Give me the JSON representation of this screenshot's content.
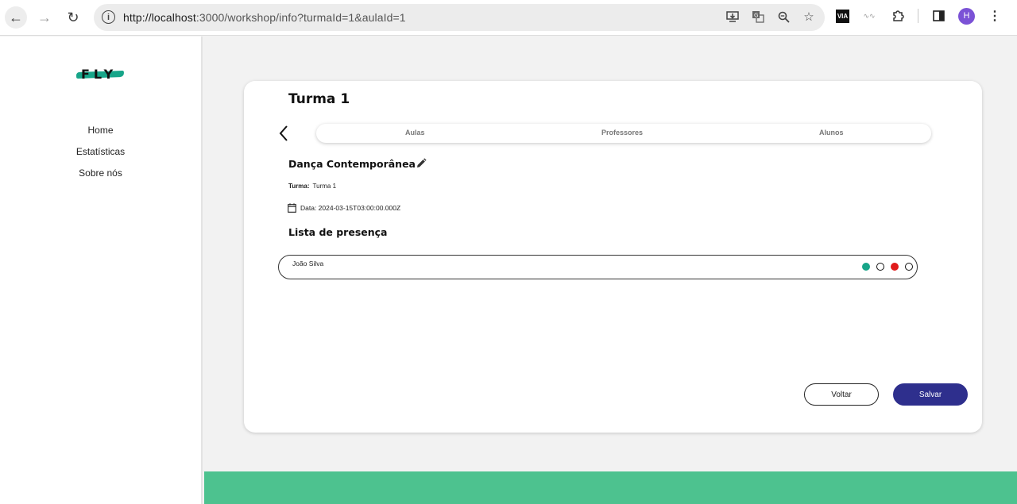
{
  "browser": {
    "url_host": "http://localhost",
    "url_rest": ":3000/workshop/info?turmaId=1&aulaId=1",
    "avatar_letter": "H",
    "ext_via_label": "VIA"
  },
  "sidebar": {
    "logo_text": "FLY",
    "items": [
      {
        "label": "Home"
      },
      {
        "label": "Estatísticas"
      },
      {
        "label": "Sobre nós"
      }
    ]
  },
  "card": {
    "title": "Turma 1",
    "tabs": [
      {
        "label": "Aulas"
      },
      {
        "label": "Professores"
      },
      {
        "label": "Alunos"
      }
    ],
    "class_name": "Dança Contemporânea",
    "turma_label": "Turma:",
    "turma_value": "Turma 1",
    "date_text": "Data: 2024-03-15T03:00:00.000Z",
    "list_title": "Lista de presença",
    "students": [
      {
        "name": "João Silva",
        "status_dots": [
          "green",
          "empty",
          "red",
          "empty"
        ]
      }
    ],
    "buttons": {
      "back": "Voltar",
      "save": "Salvar"
    }
  },
  "colors": {
    "accent_green": "#4dc28f",
    "present_green": "#17a589",
    "absent_red": "#e01b1b",
    "primary_button": "#2e2f8d"
  }
}
